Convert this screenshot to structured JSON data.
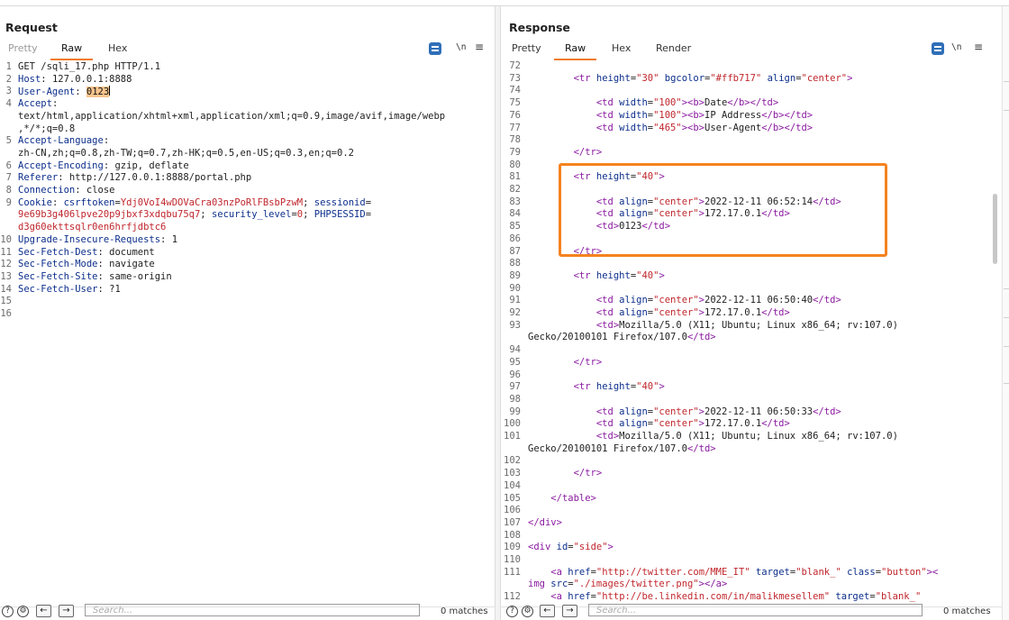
{
  "request": {
    "title": "Request",
    "tabs": [
      "Pretty",
      "Raw",
      "Hex"
    ],
    "active_tab": "Raw",
    "line_numbers": [
      "1",
      "2",
      "3",
      "4",
      "",
      "",
      "5",
      "",
      "6",
      "7",
      "8",
      "9",
      "",
      "",
      "10",
      "11",
      "12",
      "13",
      "14",
      "15",
      "16"
    ],
    "lines": {
      "l1": "GET /sqli_17.php HTTP/1.1",
      "l2k": "Host",
      "l2v": " 127.0.0.1:8888",
      "l3k": "User-Agent",
      "l3v": "0123",
      "l4k": "Accept",
      "l4v1": "text/html,application/xhtml+xml,application/xml;q=0.9,image/avif,image/webp",
      "l4v2": ",*/*;q=0.8",
      "l5k": "Accept-Language",
      "l5v": "zh-CN,zh;q=0.8,zh-TW;q=0.7,zh-HK;q=0.5,en-US;q=0.3,en;q=0.2",
      "l6k": "Accept-Encoding",
      "l6v": " gzip, deflate",
      "l7k": "Referer",
      "l7v": " http://127.0.0.1:8888/portal.php",
      "l8k": "Connection",
      "l8v": " close",
      "l9k": "Cookie",
      "c1k": "csrftoken",
      "c1v": "Ydj0VoI4wDOVaCra03nzPoRlFBsbPzwM",
      "c2k": "sessionid",
      "c2v": "9e69b3g406lpve20p9jbxf3xdqbu75q7",
      "c3k": "security_level",
      "c3v": "0",
      "c4k": "PHPSESSID",
      "c4v": "d3g60ekttsqlr0en6hrfjdbtc6",
      "l10k": "Upgrade-Insecure-Requests",
      "l10v": " 1",
      "l11k": "Sec-Fetch-Dest",
      "l11v": " document",
      "l12k": "Sec-Fetch-Mode",
      "l12v": " navigate",
      "l13k": "Sec-Fetch-Site",
      "l13v": " same-origin",
      "l14k": "Sec-Fetch-User",
      "l14v": " ?1"
    },
    "search_placeholder": "Search...",
    "matches": "0 matches"
  },
  "response": {
    "title": "Response",
    "tabs": [
      "Pretty",
      "Raw",
      "Hex",
      "Render"
    ],
    "active_tab": "Raw",
    "line_numbers": [
      "72",
      "73",
      "74",
      "75",
      "76",
      "77",
      "78",
      "79",
      "80",
      "81",
      "82",
      "83",
      "84",
      "85",
      "86",
      "87",
      "88",
      "89",
      "90",
      "91",
      "92",
      "93",
      "",
      "94",
      "95",
      "96",
      "97",
      "98",
      "99",
      "100",
      "101",
      "",
      "102",
      "103",
      "104",
      "105",
      "106",
      "107",
      "108",
      "109",
      "110",
      "111",
      "",
      "112"
    ],
    "rows": {
      "r73_attr1": "height",
      "r73_val1": "\"30\"",
      "r73_attr2": "bgcolor",
      "r73_val2": "\"#ffb717\"",
      "r73_attr3": "align",
      "r73_val3": "\"center\"",
      "width": "width",
      "w100": "\"100\"",
      "w465": "\"465\"",
      "h_date": "Date",
      "h_ip": "IP Address",
      "h_ua": "User-Agent",
      "height": "height",
      "h40": "\"40\"",
      "align": "align",
      "center": "\"center\"",
      "row1_date": "2022-12-11 06:52:14",
      "row1_ip": "172.17.0.1",
      "row1_ua": "0123",
      "row2_date": "2022-12-11 06:50:40",
      "row2_ip": "172.17.0.1",
      "row2_ua1": "Mozilla/5.0 (X11; Ubuntu; Linux x86_64; rv:107.0)",
      "row2_ua2": "Gecko/20100101 Firefox/107.0",
      "row3_date": "2022-12-11 06:50:33",
      "row3_ip": "172.17.0.1",
      "row3_ua1": "Mozilla/5.0 (X11; Ubuntu; Linux x86_64; rv:107.0)",
      "row3_ua2": "Gecko/20100101 Firefox/107.0",
      "id": "id",
      "side": "\"side\"",
      "href": "href",
      "twitter_url": "\"http://twitter.com/MME_IT\"",
      "target": "target",
      "blank": "\"blank_\"",
      "class": "class",
      "button": "\"button\"",
      "src": "src",
      "twitter_img": "\"./images/twitter.png\"",
      "linkedin_url": "\"http://be.linkedin.com/in/malikmesellem\"",
      "blank_trunc": "\"blank_\""
    },
    "search_placeholder": "Search...",
    "matches": "0 matches"
  },
  "colors": {
    "accent": "#f07b27",
    "highlight_box": "#f5821f",
    "selection": "#f9c58d",
    "tag": "#8a1aa0",
    "attr": "#0d2f8c",
    "string": "#c0272d",
    "button_blue": "#2f6fb8"
  },
  "icons": [
    "help-icon",
    "settings-icon",
    "arrow-left-icon",
    "arrow-right-icon",
    "wrap-icon",
    "newline-icon",
    "menu-icon"
  ]
}
